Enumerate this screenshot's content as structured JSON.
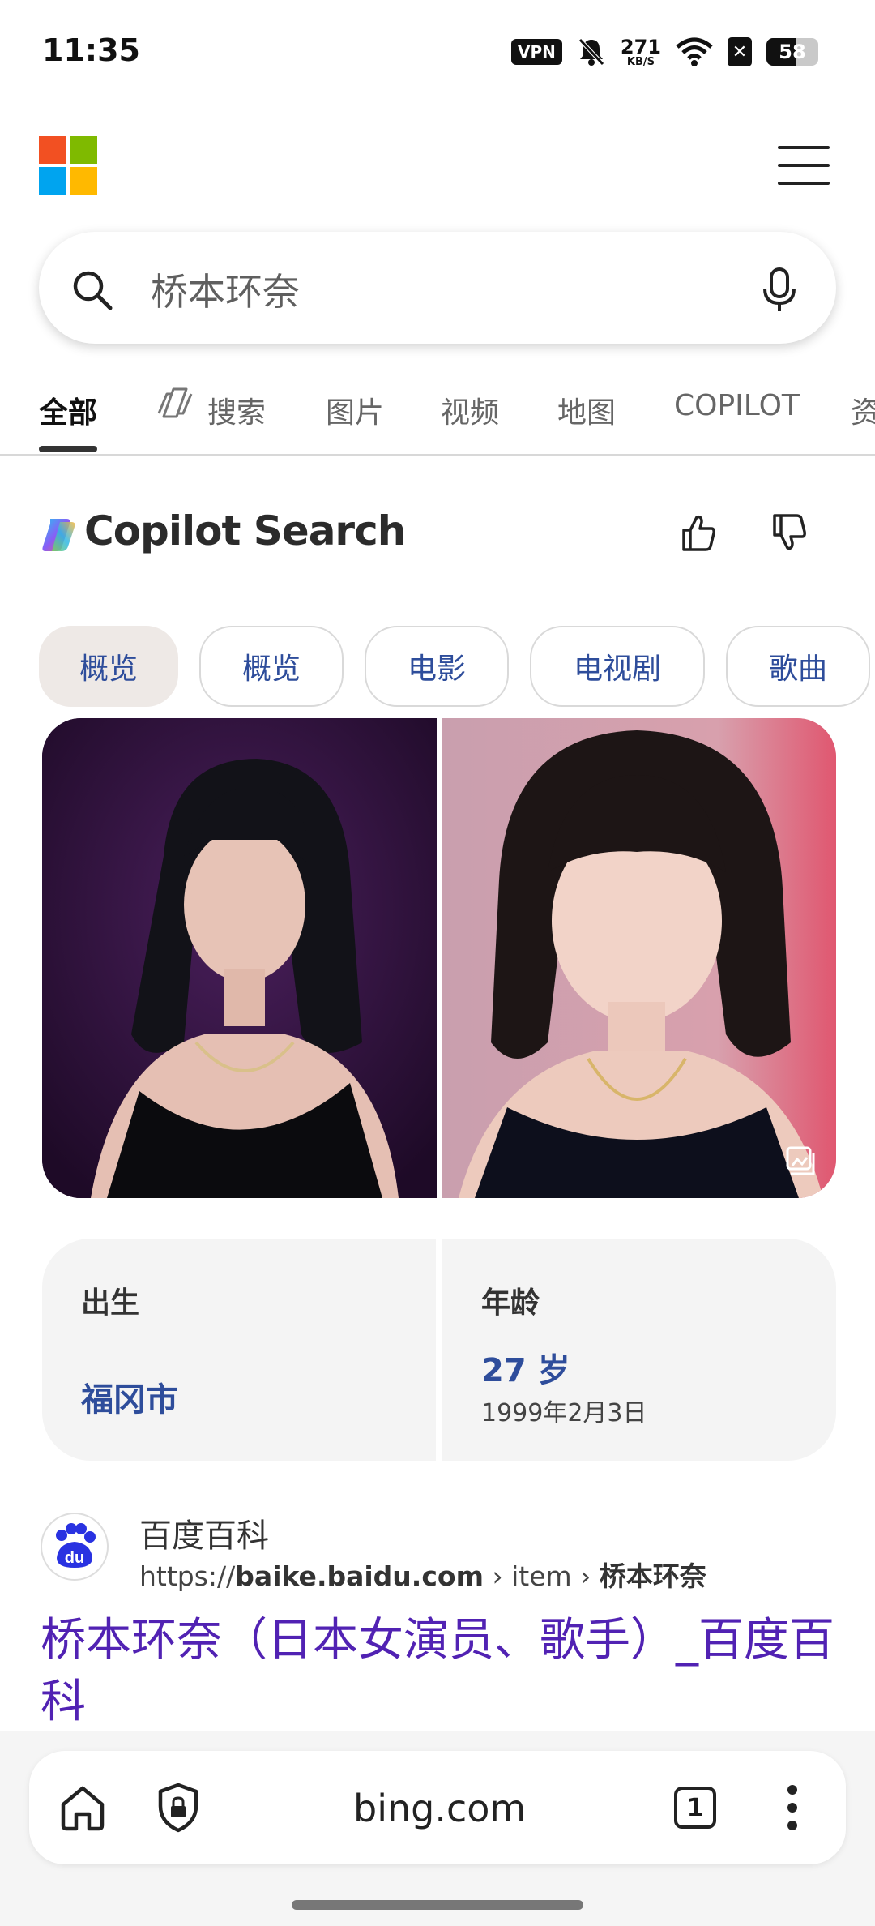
{
  "status_bar": {
    "time": "11:35",
    "vpn": "VPN",
    "net_speed": "271",
    "net_unit": "KB/S",
    "battery_level": "58"
  },
  "header": {
    "logo": "microsoft-logo",
    "menu_icon": "hamburger-menu-icon"
  },
  "search": {
    "query": "桥本环奈"
  },
  "tabs": [
    {
      "label": "全部",
      "active": true
    },
    {
      "label": "搜索",
      "active": false
    },
    {
      "label": "图片",
      "active": false
    },
    {
      "label": "视频",
      "active": false
    },
    {
      "label": "地图",
      "active": false
    },
    {
      "label": "COPILOT",
      "active": false
    },
    {
      "label": "资",
      "active": false
    }
  ],
  "copilot": {
    "title": "Copilot Search"
  },
  "chips": [
    {
      "label": "概览",
      "selected": true
    },
    {
      "label": "概览",
      "selected": false
    },
    {
      "label": "电影",
      "selected": false
    },
    {
      "label": "电视剧",
      "selected": false
    },
    {
      "label": "歌曲",
      "selected": false
    }
  ],
  "facts": {
    "birth_label": "出生",
    "birth_value": "福冈市",
    "age_label": "年龄",
    "age_value": "27 岁",
    "age_date": "1999年2月3日"
  },
  "result": {
    "source_name": "百度百科",
    "url_prefix": "https://",
    "url_domain": "baike.baidu.com",
    "url_path_1": " › item › ",
    "url_path_2": "桥本环奈",
    "title": "桥本环奈（日本女演员、歌手）_百度百科",
    "logo_text": "du"
  },
  "bottom_bar": {
    "url": "bing.com",
    "tab_count": "1"
  },
  "colors": {
    "accent_blue": "#2e4d9b",
    "link_purple": "#5122b3"
  }
}
